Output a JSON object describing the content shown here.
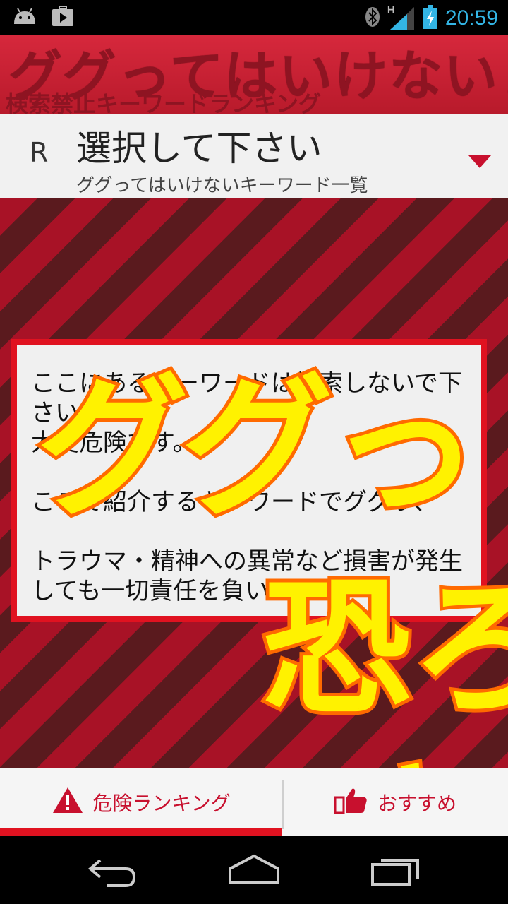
{
  "status_bar": {
    "time": "20:59",
    "network": "H",
    "icons": [
      "android-icon",
      "play-store-icon",
      "bluetooth-icon",
      "signal-icon",
      "battery-icon"
    ]
  },
  "header": {
    "title": "ググってはいけない！",
    "subtitle": "検索禁止キーワードランキング"
  },
  "selector": {
    "letter": "R",
    "title": "選択して下さい",
    "subtitle": "ググってはいけないキーワード一覧"
  },
  "notice": {
    "text": "ここにあるキーワードは検索しないで下さい！\n大変危険です。\n\nここで紹介するキーワードでググり、\n\nトラウマ・精神への異常など損害が発生しても一切責任を負いません。"
  },
  "overlay": {
    "line1": "ググっ",
    "line2": "恐ろ",
    "line3": "キ"
  },
  "tabs": [
    {
      "label": "危険ランキング",
      "icon": "warning-icon",
      "active": true
    },
    {
      "label": "おすすめ",
      "icon": "thumbs-up-icon",
      "active": false
    }
  ],
  "colors": {
    "accent": "#e01220",
    "overlay_fill": "#fff200",
    "overlay_stroke": "#ff6a00",
    "time": "#33b5e5"
  }
}
